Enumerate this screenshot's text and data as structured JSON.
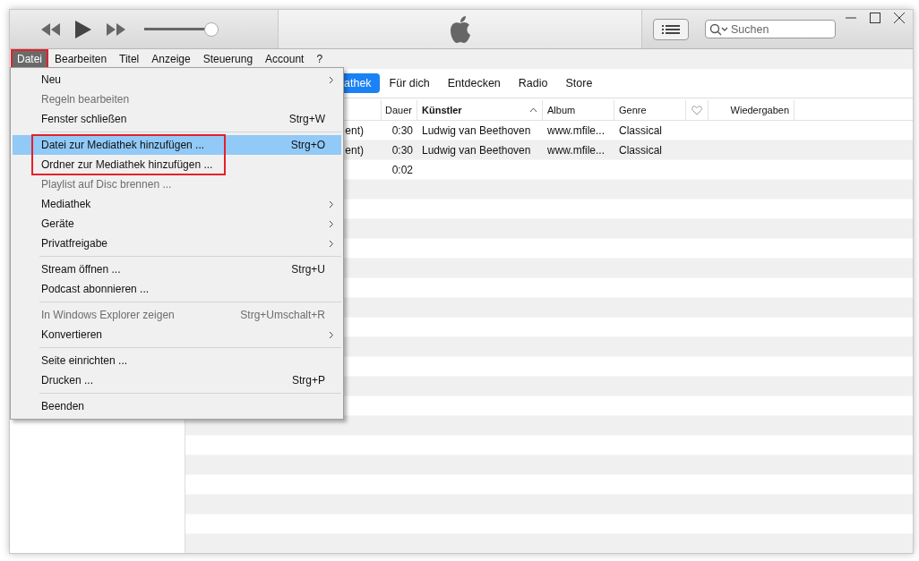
{
  "player": {
    "volume": {
      "level": 0.92
    }
  },
  "search": {
    "placeholder": "Suchen"
  },
  "menubar": [
    {
      "label": "Datei",
      "selected": true,
      "marked": true
    },
    {
      "label": "Bearbeiten",
      "selected": false,
      "marked": false
    },
    {
      "label": "Titel",
      "selected": false,
      "marked": false
    },
    {
      "label": "Anzeige",
      "selected": false,
      "marked": false
    },
    {
      "label": "Steuerung",
      "selected": false,
      "marked": false
    },
    {
      "label": "Account",
      "selected": false,
      "marked": false
    },
    {
      "label": "?",
      "selected": false,
      "marked": false
    }
  ],
  "file_menu": [
    {
      "kind": "item",
      "label": "Neu",
      "disabled": false,
      "submenu": true,
      "selected": false,
      "marked": false
    },
    {
      "kind": "item",
      "label": "Regeln bearbeiten",
      "disabled": true,
      "submenu": false,
      "selected": false,
      "marked": false
    },
    {
      "kind": "item",
      "label": "Fenster schließen",
      "shortcut": "Strg+W",
      "disabled": false,
      "submenu": false,
      "selected": false,
      "marked": false
    },
    {
      "kind": "separator"
    },
    {
      "kind": "item",
      "label": "Datei zur Mediathek hinzufügen ...",
      "shortcut": "Strg+O",
      "disabled": false,
      "submenu": false,
      "selected": true,
      "marked": true
    },
    {
      "kind": "item",
      "label": "Ordner zur Mediathek hinzufügen ...",
      "disabled": false,
      "submenu": false,
      "selected": false,
      "marked": true
    },
    {
      "kind": "item",
      "label": "Playlist auf Disc brennen ...",
      "disabled": true,
      "submenu": false,
      "selected": false,
      "marked": false
    },
    {
      "kind": "item",
      "label": "Mediathek",
      "disabled": false,
      "submenu": true,
      "selected": false,
      "marked": false
    },
    {
      "kind": "item",
      "label": "Geräte",
      "disabled": false,
      "submenu": true,
      "selected": false,
      "marked": false
    },
    {
      "kind": "item",
      "label": "Privatfreigabe",
      "disabled": false,
      "submenu": true,
      "selected": false,
      "marked": false
    },
    {
      "kind": "separator"
    },
    {
      "kind": "item",
      "label": "Stream öffnen ...",
      "shortcut": "Strg+U",
      "disabled": false,
      "submenu": false,
      "selected": false,
      "marked": false
    },
    {
      "kind": "item",
      "label": "Podcast abonnieren ...",
      "disabled": false,
      "submenu": false,
      "selected": false,
      "marked": false
    },
    {
      "kind": "separator"
    },
    {
      "kind": "item",
      "label": "In Windows Explorer zeigen",
      "shortcut": "Strg+Umschalt+R",
      "disabled": true,
      "submenu": false,
      "selected": false,
      "marked": false
    },
    {
      "kind": "item",
      "label": "Konvertieren",
      "disabled": false,
      "submenu": true,
      "selected": false,
      "marked": false
    },
    {
      "kind": "separator"
    },
    {
      "kind": "item",
      "label": "Seite einrichten ...",
      "disabled": false,
      "submenu": false,
      "selected": false,
      "marked": false
    },
    {
      "kind": "item",
      "label": "Drucken ...",
      "shortcut": "Strg+P",
      "disabled": false,
      "submenu": false,
      "selected": false,
      "marked": false
    },
    {
      "kind": "separator"
    },
    {
      "kind": "item",
      "label": "Beenden",
      "disabled": false,
      "submenu": false,
      "selected": false,
      "marked": false
    }
  ],
  "tabs": [
    {
      "label": "athek",
      "selected": true
    },
    {
      "label": "Für dich",
      "selected": false
    },
    {
      "label": "Entdecken",
      "selected": false
    },
    {
      "label": "Radio",
      "selected": false
    },
    {
      "label": "Store",
      "selected": false
    }
  ],
  "table": {
    "columns": [
      {
        "kind": "blank"
      },
      {
        "kind": "text",
        "label": "Dauer",
        "sorted": false
      },
      {
        "kind": "text",
        "label": "Künstler",
        "sorted": true
      },
      {
        "kind": "text",
        "label": "Album",
        "sorted": false
      },
      {
        "kind": "text",
        "label": "Genre",
        "sorted": false
      },
      {
        "kind": "heart"
      },
      {
        "kind": "text",
        "label": "Wiedergaben",
        "sorted": false
      }
    ],
    "rows": [
      [
        "ent)",
        "0:30",
        "Ludwig van Beethoven",
        "www.mfile...",
        "Classical",
        null,
        null
      ],
      [
        "ent)",
        "0:30",
        "Ludwig van Beethoven",
        "www.mfile...",
        "Classical",
        null,
        null
      ],
      [
        null,
        "0:02",
        null,
        null,
        null,
        null,
        null
      ]
    ]
  }
}
